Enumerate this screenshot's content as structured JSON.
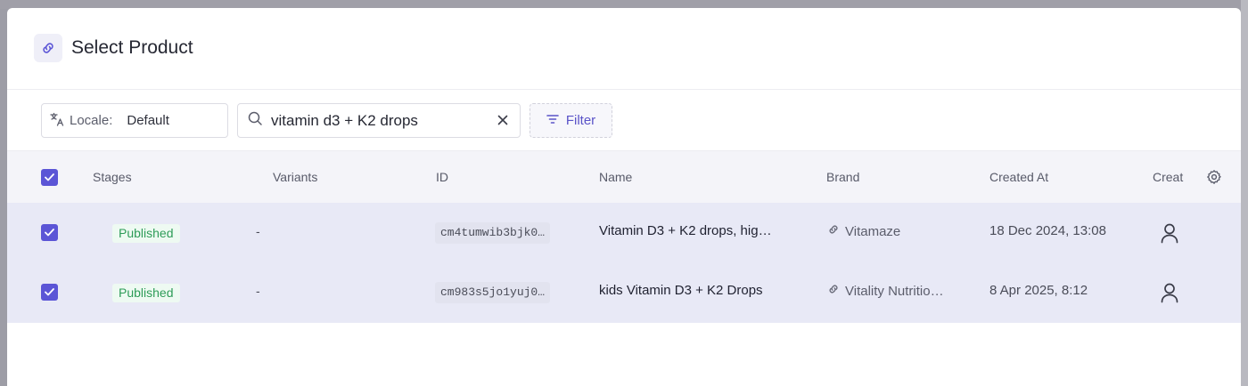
{
  "modal": {
    "title": "Select Product"
  },
  "toolbar": {
    "locale_label": "Locale:",
    "locale_value": "Default",
    "search_value": "vitamin d3 + K2 drops",
    "filter_label": "Filter"
  },
  "table": {
    "columns": [
      "Stages",
      "Variants",
      "ID",
      "Name",
      "Brand",
      "Created At",
      "Creat"
    ],
    "rows": [
      {
        "stage": "Published",
        "variants": "-",
        "id": "cm4tumwib3bjk0…",
        "name": "Vitamin D3 + K2 drops, hig…",
        "brand": "Vitamaze",
        "created_at": "18 Dec 2024, 13:08",
        "selected": true
      },
      {
        "stage": "Published",
        "variants": "-",
        "id": "cm983s5jo1yuj0…",
        "name": "kids Vitamin D3 + K2 Drops",
        "brand": "Vitality Nutritio…",
        "created_at": "8 Apr 2025, 8:12",
        "selected": true
      }
    ]
  },
  "colors": {
    "accent": "#5b55d6",
    "published_text": "#2e9c58",
    "selected_row_bg": "#e8e9f6"
  },
  "icons": {
    "header": "link-icon",
    "locale": "translate-icon",
    "search": "search-icon",
    "clear": "close-icon",
    "filter": "filter-lines-icon",
    "settings": "gear-icon",
    "brand": "link-icon",
    "creator": "user-icon"
  }
}
